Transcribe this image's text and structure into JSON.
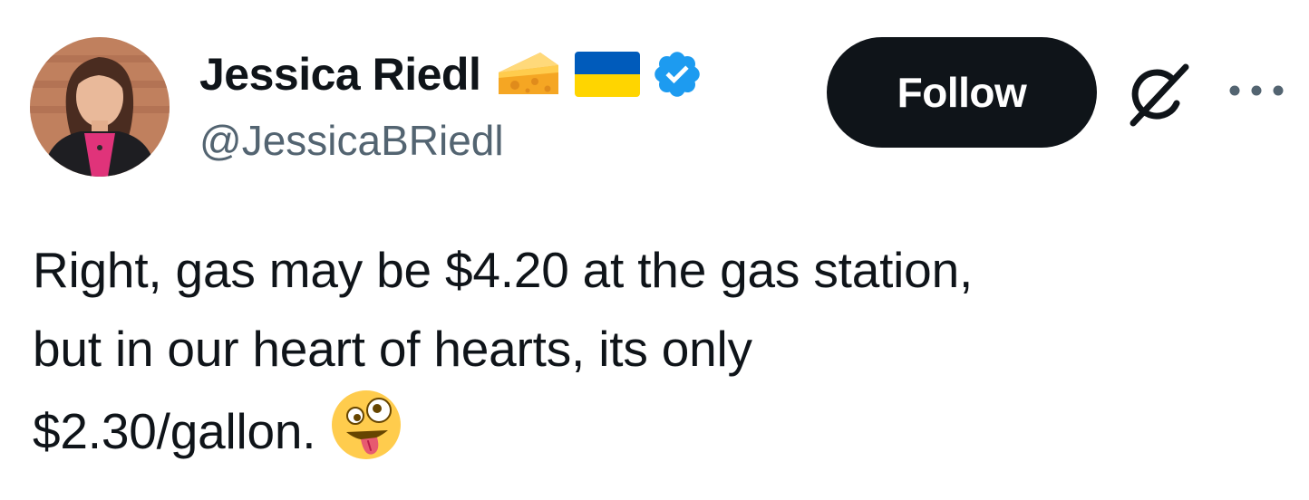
{
  "author": {
    "display_name": "Jessica Riedl",
    "handle": "@JessicaBRiedl",
    "name_emojis": [
      "cheese-emoji",
      "ukraine-flag-emoji"
    ],
    "verified": true,
    "verified_badge_color": "#1d9bf0"
  },
  "actions": {
    "follow_label": "Follow",
    "follow_button_color": "#0f1419",
    "grok_icon": "grok-icon",
    "more_icon": "more-icon"
  },
  "tweet": {
    "lines": [
      "Right, gas may be $4.20 at the gas station,",
      "but in our heart of hearts, its only",
      "$2.30/gallon."
    ],
    "trailing_emoji": "zany-face-emoji"
  },
  "colors": {
    "text": "#0f1419",
    "secondary_text": "#536471",
    "background": "#ffffff"
  }
}
